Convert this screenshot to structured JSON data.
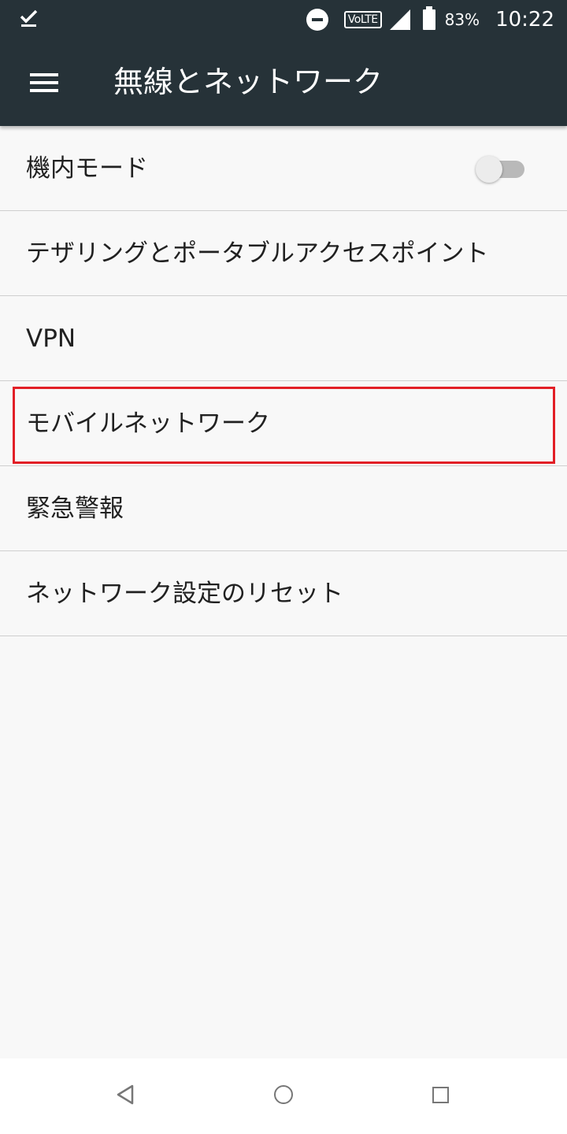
{
  "status_bar": {
    "left_icon": "check-download-icon",
    "dnd_icon": "do-not-disturb-icon",
    "volte_label": "VoLTE",
    "signal_icon": "cell-signal-icon",
    "battery_icon": "battery-icon",
    "battery_percent": "83%",
    "time": "10:22"
  },
  "app_bar": {
    "menu_icon": "hamburger-menu-icon",
    "title": "無線とネットワーク",
    "background": "#263238"
  },
  "settings": {
    "items": [
      {
        "label": "機内モード",
        "toggle": {
          "on": false
        }
      },
      {
        "label": "テザリングとポータブルアクセスポイント"
      },
      {
        "label": "VPN"
      },
      {
        "label": "モバイルネットワーク",
        "highlighted": true
      },
      {
        "label": "緊急警報"
      },
      {
        "label": "ネットワーク設定のリセット"
      }
    ]
  },
  "highlight_color": "#e21f26",
  "nav_bar": {
    "back_icon": "back-triangle-icon",
    "home_icon": "home-circle-icon",
    "recents_icon": "recents-square-icon"
  }
}
